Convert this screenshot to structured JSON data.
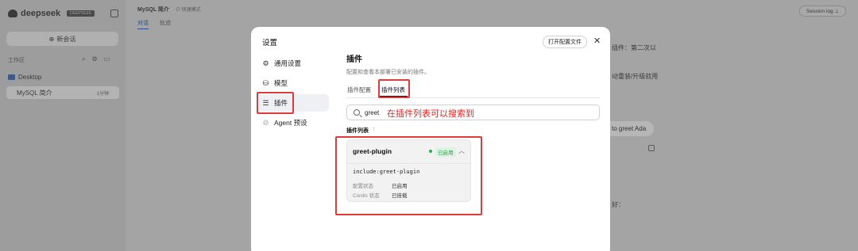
{
  "app": {
    "brand": "deepseek",
    "brand_badge": "DEEPSEEK",
    "new_chat": "新会话",
    "workspace_label": "工作区",
    "folder": "Desktop",
    "session_title": "MySQL 简介",
    "session_time": "1分钟",
    "topbar_title": "MySQL 简介",
    "topbar_mode": "⊙ 快速模式",
    "tab_chat": "对话",
    "tab_trace": "轨迹",
    "session_log": "Session log ⊥",
    "ghost_right_1": "插件：第二次以",
    "ghost_right_2": "动重装/升级就用",
    "bubble": "to greet Ada",
    "ghost_right_3": "好："
  },
  "modal": {
    "title": "设置",
    "nav": [
      {
        "label": "通用设置",
        "icon": "gear-icon"
      },
      {
        "label": "模型",
        "icon": "cube-icon"
      },
      {
        "label": "插件",
        "icon": "sliders-icon"
      },
      {
        "label": "Agent 预设",
        "icon": "robot-icon"
      }
    ],
    "open_config": "打开配置文件",
    "close": "✕",
    "section_title": "插件",
    "section_desc": "配置和查看本部署已安装的插件。",
    "subtab_config": "插件配置",
    "subtab_list": "插件列表",
    "search_value": "greet",
    "annotation": "在插件列表可以搜索到",
    "list_label": "插件列表",
    "list_arrow": "↑",
    "plugin": {
      "name": "greet-plugin",
      "status_badge": "已启用",
      "code": "include:greet-plugin",
      "rows": [
        {
          "k": "配置状态",
          "v": "已启用"
        },
        {
          "k": "Cordis 状态",
          "v": "已挂载"
        }
      ]
    }
  },
  "colors": {
    "accent_red": "#e23a3a",
    "enabled_green": "#22b14c"
  }
}
